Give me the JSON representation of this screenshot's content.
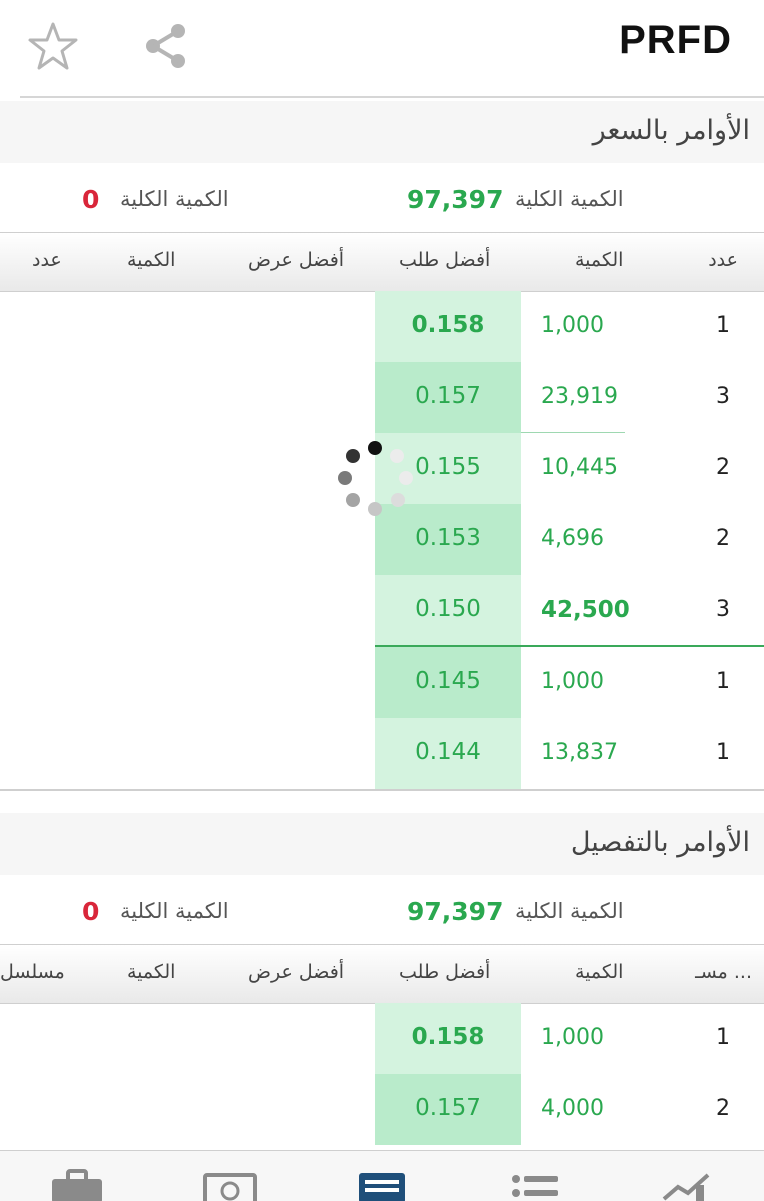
{
  "header": {
    "title": "PRFD",
    "favorite_icon": "star-icon",
    "share_icon": "share-icon"
  },
  "section_price": {
    "title": "الأوامر بالسعر",
    "bid_total_label": "الكمية الكلية",
    "bid_total_value": "97,397",
    "ask_total_label": "الكمية الكلية",
    "ask_total_value": "0",
    "columns": {
      "count": "عدد",
      "qty": "الكمية",
      "best_bid": "أفضل طلب",
      "best_offer": "أفضل عرض",
      "offer_qty": "الكمية",
      "offer_count": "عدد"
    },
    "rows": [
      {
        "count": "1",
        "qty": "1,000",
        "bid": "0.158"
      },
      {
        "count": "3",
        "qty": "23,919",
        "bid": "0.157"
      },
      {
        "count": "2",
        "qty": "10,445",
        "bid": "0.155"
      },
      {
        "count": "2",
        "qty": "4,696",
        "bid": "0.153"
      },
      {
        "count": "3",
        "qty": "42,500",
        "bid": "0.150"
      },
      {
        "count": "1",
        "qty": "1,000",
        "bid": "0.145"
      },
      {
        "count": "1",
        "qty": "13,837",
        "bid": "0.144"
      }
    ]
  },
  "section_detail": {
    "title": "الأوامر بالتفصيل",
    "bid_total_label": "الكمية الكلية",
    "bid_total_value": "97,397",
    "ask_total_label": "الكمية الكلية",
    "ask_total_value": "0",
    "columns": {
      "serial": "مسـ ...",
      "qty": "الكمية",
      "best_bid": "أفضل طلب",
      "best_offer": "أفضل عرض",
      "offer_qty": "الكمية",
      "offer_serial": "مسلسل"
    },
    "rows": [
      {
        "serial": "1",
        "qty": "1,000",
        "bid": "0.158"
      },
      {
        "serial": "2",
        "qty": "4,000",
        "bid": "0.157"
      }
    ]
  },
  "tabbar": {
    "icons": [
      "briefcase-icon",
      "cash-icon",
      "orderbook-icon",
      "list-icon",
      "chart-icon"
    ]
  },
  "colors": {
    "green": "#2aa84f",
    "red": "#d9263a",
    "bid_light": "#d4f3df",
    "bid_dark": "#b9ebcb"
  }
}
